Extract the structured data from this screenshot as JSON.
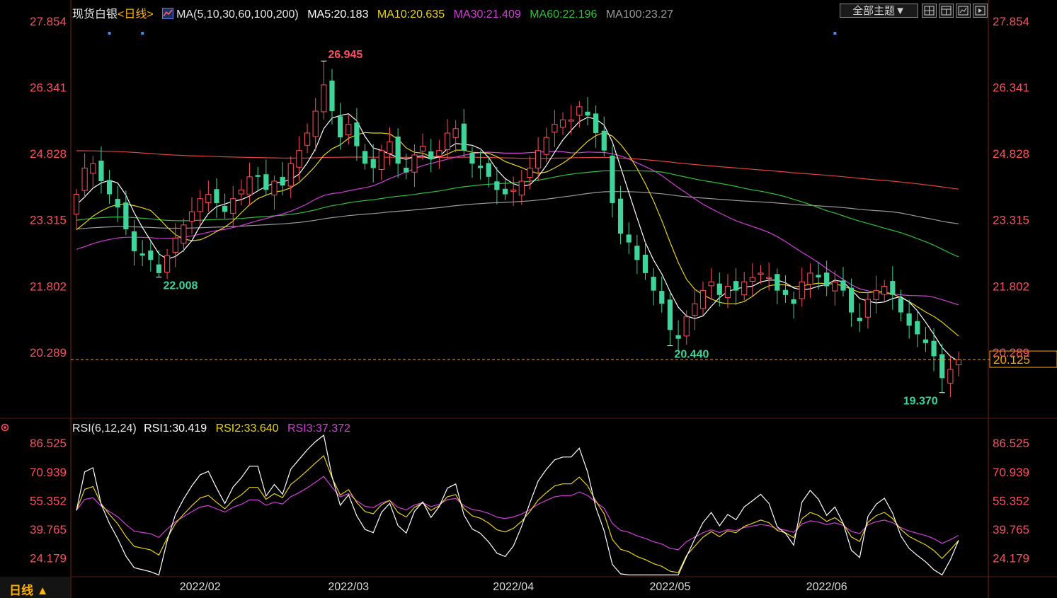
{
  "header": {
    "instrument": "现货白银",
    "period_tag": "<日线>",
    "ma_label": "MA(5,10,30,60,100,200)",
    "ma5": "MA5:20.183",
    "ma10": "MA10:20.635",
    "ma30": "MA30:21.409",
    "ma60": "MA60:22.196",
    "ma100": "MA100:23.27",
    "theme_button": "全部主题▼"
  },
  "rsi_header": {
    "label": "RSI(6,12,24)",
    "rsi1": "RSI1:30.419",
    "rsi2": "RSI2:33.640",
    "rsi3": "RSI3:37.372"
  },
  "footer": {
    "period": "日线 ▲"
  },
  "colors": {
    "up": "#ff4d5e",
    "down": "#3fd49a",
    "ma5": "#ffffff",
    "ma10": "#e8d21a",
    "ma30": "#d43ed9",
    "ma60": "#2fbf3a",
    "ma100": "#9a9a9a",
    "ma200": "#e0443a",
    "price_axis": "#ff4d5e",
    "last_price": "#ffa500"
  },
  "chart_data": [
    {
      "type": "candlestick",
      "yticks": [
        "27.854",
        "26.341",
        "24.828",
        "23.315",
        "21.802",
        "20.289"
      ],
      "ylim": [
        18.8,
        27.854
      ],
      "xticks": [
        "2022/02",
        "2022/03",
        "2022/04",
        "2022/05",
        "2022/06"
      ],
      "xtick_index": [
        15,
        33,
        53,
        72,
        91
      ],
      "last_price": "20.125",
      "last_price_value": 20.125,
      "annotations": [
        {
          "text": "26.945",
          "index": 30,
          "value": 26.945,
          "side": "right",
          "color": "up"
        },
        {
          "text": "22.008",
          "index": 10,
          "value": 22.008,
          "side": "right",
          "color": "down"
        },
        {
          "text": "20.440",
          "index": 72,
          "value": 20.44,
          "side": "right",
          "color": "down"
        },
        {
          "text": "19.370",
          "index": 105,
          "value": 19.37,
          "side": "left",
          "color": "down"
        }
      ],
      "markers": [
        4,
        8,
        92
      ],
      "close": [
        23.9,
        24.5,
        24.6,
        24.2,
        23.9,
        23.6,
        23.1,
        22.6,
        22.5,
        22.4,
        22.1,
        22.5,
        22.9,
        23.2,
        23.5,
        23.8,
        23.9,
        23.7,
        23.5,
        23.8,
        24.0,
        24.3,
        24.3,
        24.0,
        24.2,
        24.1,
        24.6,
        24.9,
        25.3,
        25.8,
        26.4,
        25.8,
        25.2,
        25.5,
        25.0,
        24.6,
        24.5,
        24.9,
        25.1,
        24.6,
        24.4,
        24.8,
        25.0,
        24.7,
        24.9,
        25.3,
        25.4,
        24.9,
        24.6,
        24.5,
        24.3,
        24.0,
        23.9,
        24.0,
        24.2,
        24.5,
        24.9,
        25.2,
        25.5,
        25.6,
        25.6,
        25.9,
        25.7,
        25.3,
        24.9,
        23.7,
        23.0,
        22.8,
        22.4,
        22.1,
        21.7,
        21.4,
        20.8,
        20.6,
        21.1,
        21.4,
        21.7,
        21.9,
        21.6,
        21.8,
        21.7,
        21.9,
        22.0,
        22.1,
        22.0,
        21.7,
        21.6,
        21.4,
        21.9,
        22.1,
        22.0,
        21.8,
        21.9,
        21.7,
        21.2,
        21.0,
        21.5,
        21.7,
        21.8,
        21.6,
        21.2,
        20.9,
        20.7,
        20.5,
        20.2,
        19.7,
        19.9,
        20.125
      ],
      "rsi": {
        "yticks": [
          "86.525",
          "70.939",
          "55.352",
          "39.765",
          "24.179"
        ],
        "ylim": [
          14.0,
          92.0
        ]
      }
    }
  ]
}
